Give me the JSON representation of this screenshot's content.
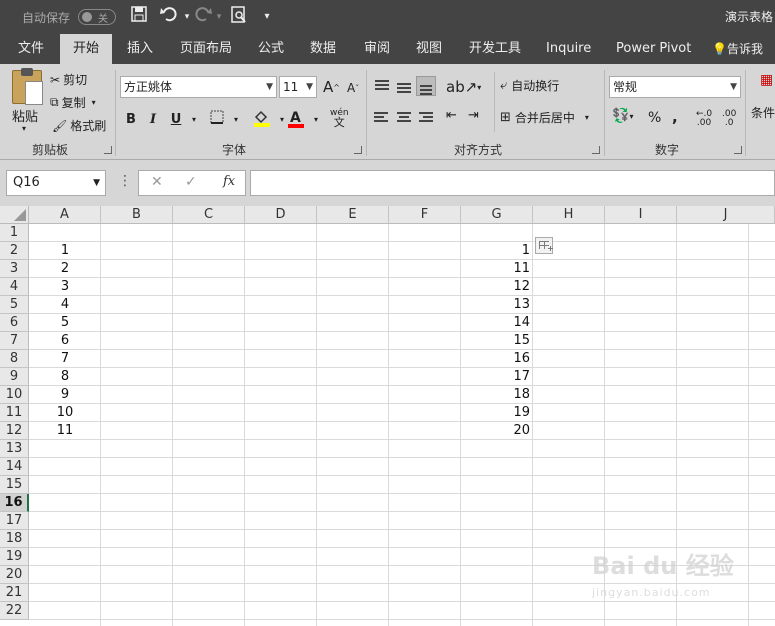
{
  "titlebar": {
    "autosave_label": "自动保存",
    "autosave_state": "关",
    "doc_title": "演示表格"
  },
  "tabs": [
    "文件",
    "开始",
    "插入",
    "页面布局",
    "公式",
    "数据",
    "审阅",
    "视图",
    "开发工具",
    "Inquire",
    "Power Pivot",
    "告诉我你"
  ],
  "ribbon": {
    "clipboard": {
      "paste": "粘贴",
      "cut": "剪切",
      "copy": "复制",
      "painter": "格式刷",
      "label": "剪贴板"
    },
    "font": {
      "name": "方正姚体",
      "size": "11",
      "bold": "B",
      "italic": "I",
      "underline": "U",
      "label": "字体",
      "grow": "A",
      "shrink": "A",
      "phonetic_top": "wén",
      "phonetic_bottom": "文"
    },
    "alignment": {
      "wrap": "自动换行",
      "merge": "合并后居中",
      "label": "对齐方式"
    },
    "number": {
      "format": "常规",
      "percent": "%",
      "comma": ",",
      "inc_decimal": ".00",
      "dec_decimal": ".0",
      "label": "数字"
    },
    "styles": {
      "conditional": "条件"
    }
  },
  "formula_bar": {
    "name_box": "Q16",
    "fx": "fx",
    "value": ""
  },
  "sheet": {
    "columns": [
      "A",
      "B",
      "C",
      "D",
      "E",
      "F",
      "G",
      "H",
      "I",
      "J"
    ],
    "rows": [
      "1",
      "2",
      "3",
      "4",
      "5",
      "6",
      "7",
      "8",
      "9",
      "10",
      "11",
      "12",
      "13",
      "14",
      "15",
      "16",
      "17",
      "18",
      "19",
      "20",
      "21",
      "22"
    ],
    "active_row": "16",
    "col_a": [
      "1",
      "2",
      "3",
      "4",
      "5",
      "6",
      "7",
      "8",
      "9",
      "10",
      "11"
    ],
    "col_g": [
      "1",
      "11",
      "12",
      "13",
      "14",
      "15",
      "16",
      "17",
      "18",
      "19",
      "20"
    ]
  },
  "watermark": {
    "brand": "Bai du 经验",
    "url": "jingyan.baidu.com"
  }
}
